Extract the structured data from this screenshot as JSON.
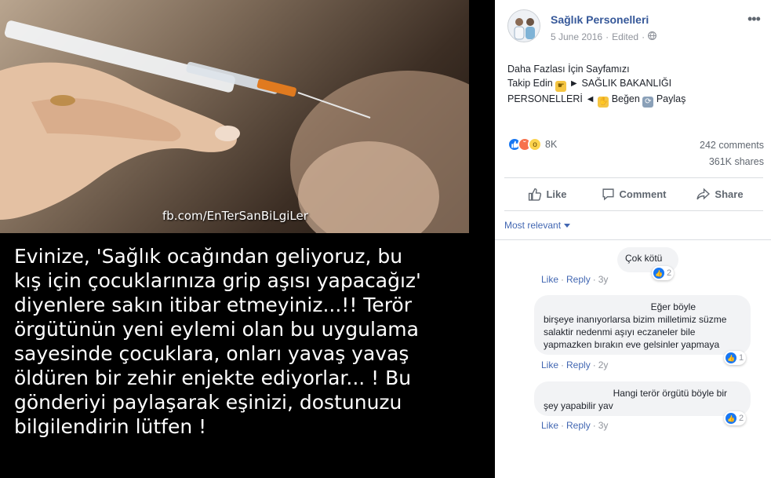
{
  "media": {
    "watermark": "fb.com/EnTerSanBiLgiLer",
    "caption_lines": [
      "Evinize, 'Sağlık ocağından geliyoruz, bu",
      "kış için çocuklarınıza grip aşısı yapacağız'",
      "diyenlere sakın itibar etmeyiniz...!! Terör",
      "örgütünün yeni eylemi olan bu uygulama",
      "sayesinde çocuklara, onları yavaş yavaş",
      "öldüren bir zehir enjekte ediyorlar... ! Bu",
      "gönderiyi paylaşarak eşinizi, dostunuzu",
      "bilgilendirin lütfen !"
    ]
  },
  "post": {
    "page_name": "Sağlık Personelleri",
    "date": "5 June 2016",
    "edited": "Edited",
    "text": {
      "line1": "Daha Fazlası İçin Sayfamızı",
      "line2_a": "Takip Edin",
      "line2_b": "► SAĞLIK BAKANLIĞI",
      "line3_a": "PERSONELLERİ ◄",
      "line3_b": "Beğen",
      "line3_c": "Paylaş"
    },
    "reactions_count": "8K",
    "comments_count": "242 comments",
    "shares_count": "361K shares"
  },
  "actions": {
    "like": "Like",
    "comment": "Comment",
    "share": "Share"
  },
  "sort_label": "Most relevant",
  "comments": [
    {
      "text_lines": [
        "Çok kötü"
      ],
      "likes": "2",
      "like": "Like",
      "reply": "Reply",
      "time": "3y"
    },
    {
      "text_lines": [
        "Eğer böyle",
        "birşeye inanıyorlarsa bizim milletimiz süzme",
        "salaktir nedenmi aşıyı eczaneler bile",
        "yapmazken bırakın eve gelsinler yapmaya"
      ],
      "likes": "1",
      "like": "Like",
      "reply": "Reply",
      "time": "2y"
    },
    {
      "text_lines": [
        "Hangi terör örgütü böyle bir",
        "şey yapabilir yav"
      ],
      "likes": "2",
      "like": "Like",
      "reply": "Reply",
      "time": "3y"
    }
  ],
  "colors": {
    "link": "#365899",
    "like_blue": "#1877f2",
    "angry": "#f7714c",
    "wow": "#fcd34d"
  },
  "icons": [
    "more-dots-icon",
    "globe-icon",
    "like-thumb-icon",
    "comment-bubble-icon",
    "share-arrow-icon",
    "caret-down-icon"
  ]
}
